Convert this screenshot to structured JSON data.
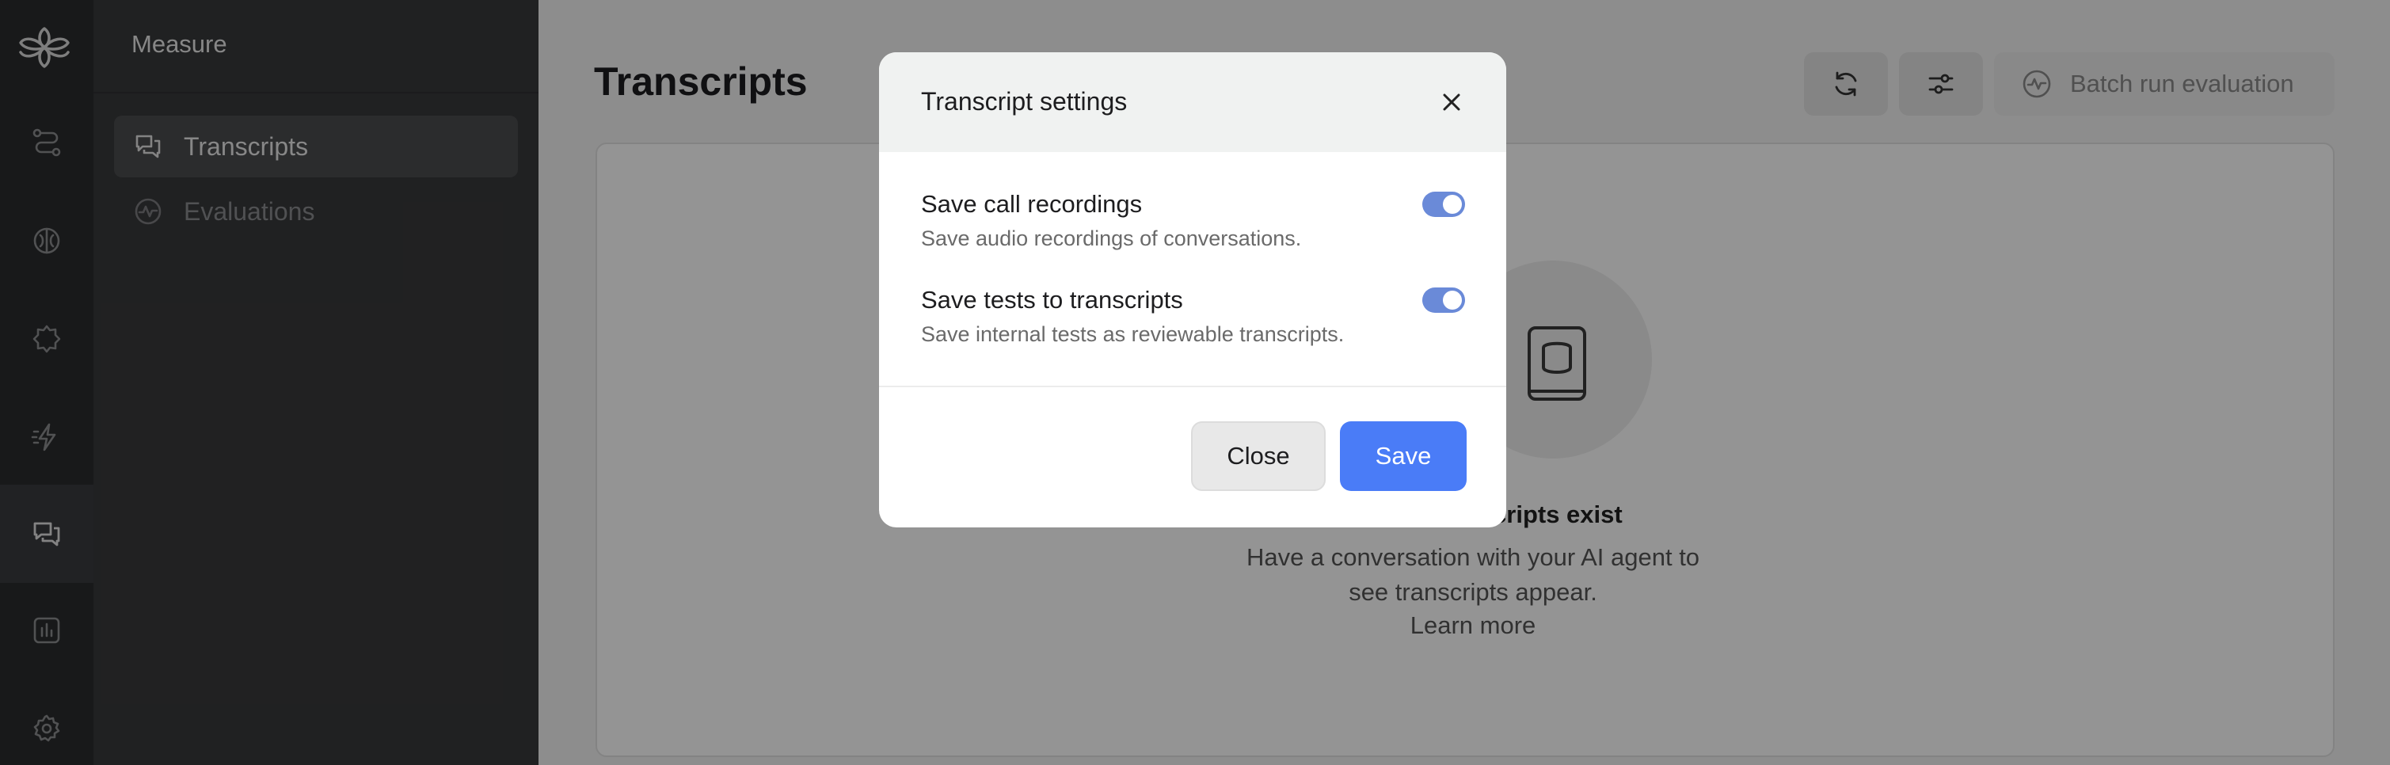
{
  "sidebar": {
    "section_title": "Measure",
    "items": [
      {
        "label": "Transcripts",
        "icon": "chat-bubbles-icon",
        "active": true
      },
      {
        "label": "Evaluations",
        "icon": "pulse-circle-icon",
        "active": false
      }
    ],
    "rail_icons": [
      "logo-icon",
      "flow-icon",
      "brain-icon",
      "puzzle-icon",
      "bolt-icon",
      "chat-bubbles-icon",
      "bar-chart-icon",
      "gear-icon"
    ],
    "active_rail_icon": "chat-bubbles-icon"
  },
  "main": {
    "title": "Transcripts",
    "batch_button_label": "Batch run evaluation",
    "empty_state": {
      "title": "No transcripts exist",
      "description": "Have a conversation with your AI agent to see transcripts appear.",
      "link": "Learn more"
    }
  },
  "modal": {
    "title": "Transcript settings",
    "settings": [
      {
        "label": "Save call recordings",
        "description": "Save audio recordings of conversations.",
        "enabled": true
      },
      {
        "label": "Save tests to transcripts",
        "description": "Save internal tests as reviewable transcripts.",
        "enabled": true
      }
    ],
    "close_label": "Close",
    "save_label": "Save"
  },
  "colors": {
    "accent": "#4a7cf7",
    "toggle_on": "#6a8ad8",
    "rail_bg": "#2a2b2d",
    "subnav_bg": "#38393b"
  }
}
